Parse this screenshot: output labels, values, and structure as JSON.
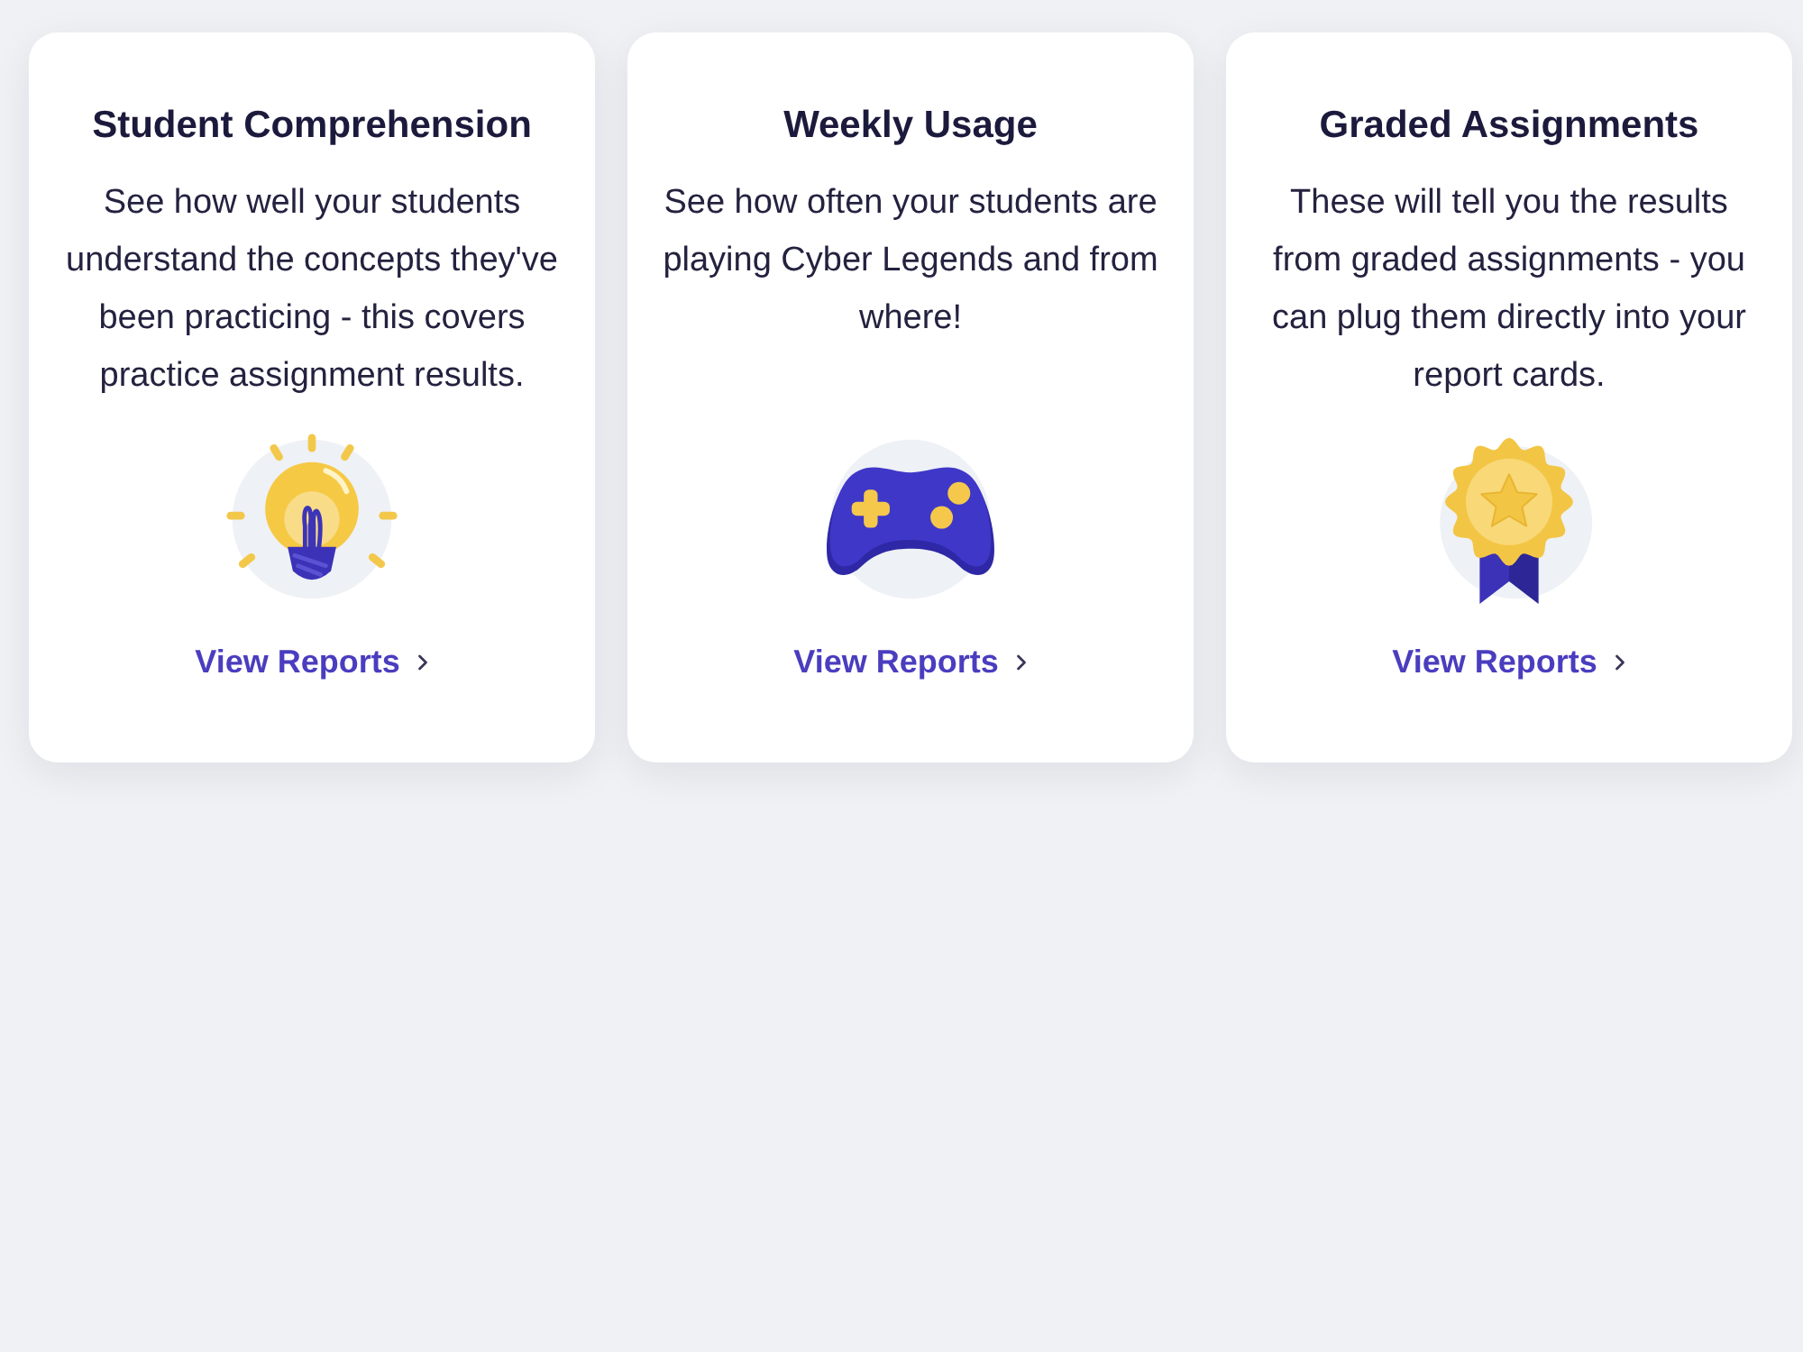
{
  "cards": [
    {
      "title": "Student Comprehension",
      "description": "See how well your students understand the concepts they've been practicing - this covers practice assignment results.",
      "kind": "lightbulb",
      "link": "View Reports"
    },
    {
      "title": "Weekly Usage",
      "description": "See how often your students are playing Cyber Legends and from where!",
      "kind": "gamepad",
      "link": "View Reports"
    },
    {
      "title": "Graded Assignments",
      "description": "These will tell you the results from graded assignments - you can plug them directly into your report cards.",
      "kind": "medal",
      "link": "View Reports"
    }
  ]
}
